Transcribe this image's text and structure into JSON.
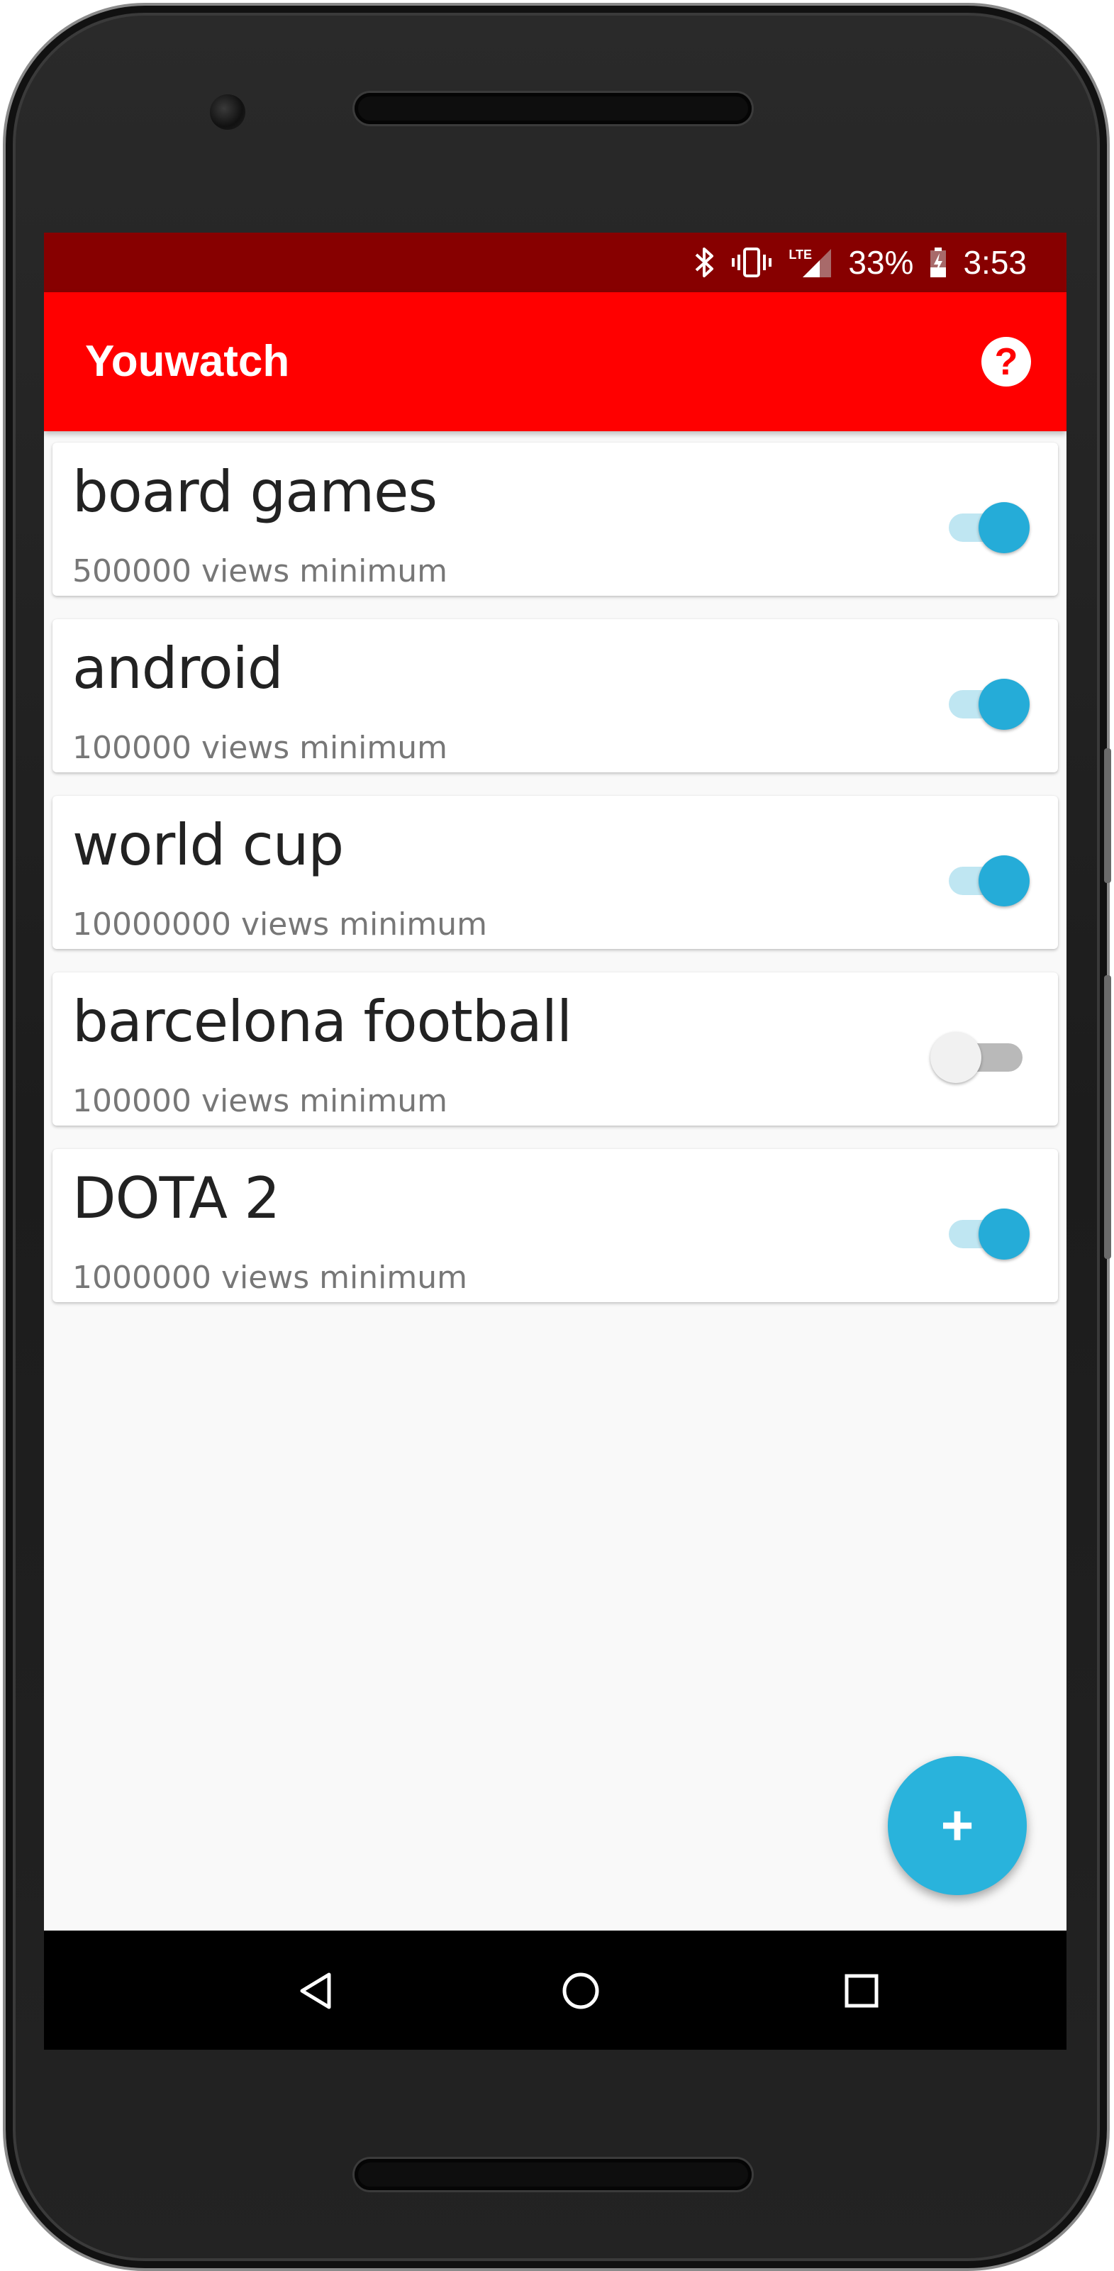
{
  "status_bar": {
    "icons": [
      "bluetooth-icon",
      "vibrate-icon",
      "lte-signal-icon",
      "battery-charging-icon"
    ],
    "lte_label": "LTE",
    "battery": "33%",
    "time": "3:53"
  },
  "app_bar": {
    "title": "Youwatch",
    "help_icon": "help-circle-icon",
    "help_label": "?"
  },
  "colors": {
    "status_bar": "#870000",
    "app_bar": "#ff0000",
    "accent": "#25acd8"
  },
  "topics": [
    {
      "title": "board games",
      "subtitle": "500000 views minimum",
      "enabled": true
    },
    {
      "title": "android",
      "subtitle": "100000 views minimum",
      "enabled": true
    },
    {
      "title": "world cup",
      "subtitle": "10000000 views minimum",
      "enabled": true
    },
    {
      "title": "barcelona football",
      "subtitle": "100000 views minimum",
      "enabled": false
    },
    {
      "title": "DOTA 2",
      "subtitle": "1000000 views minimum",
      "enabled": true
    }
  ],
  "fab": {
    "icon": "plus-icon",
    "label": "+"
  },
  "nav_bar": {
    "icons": [
      "back-icon",
      "home-icon",
      "recents-icon"
    ]
  }
}
